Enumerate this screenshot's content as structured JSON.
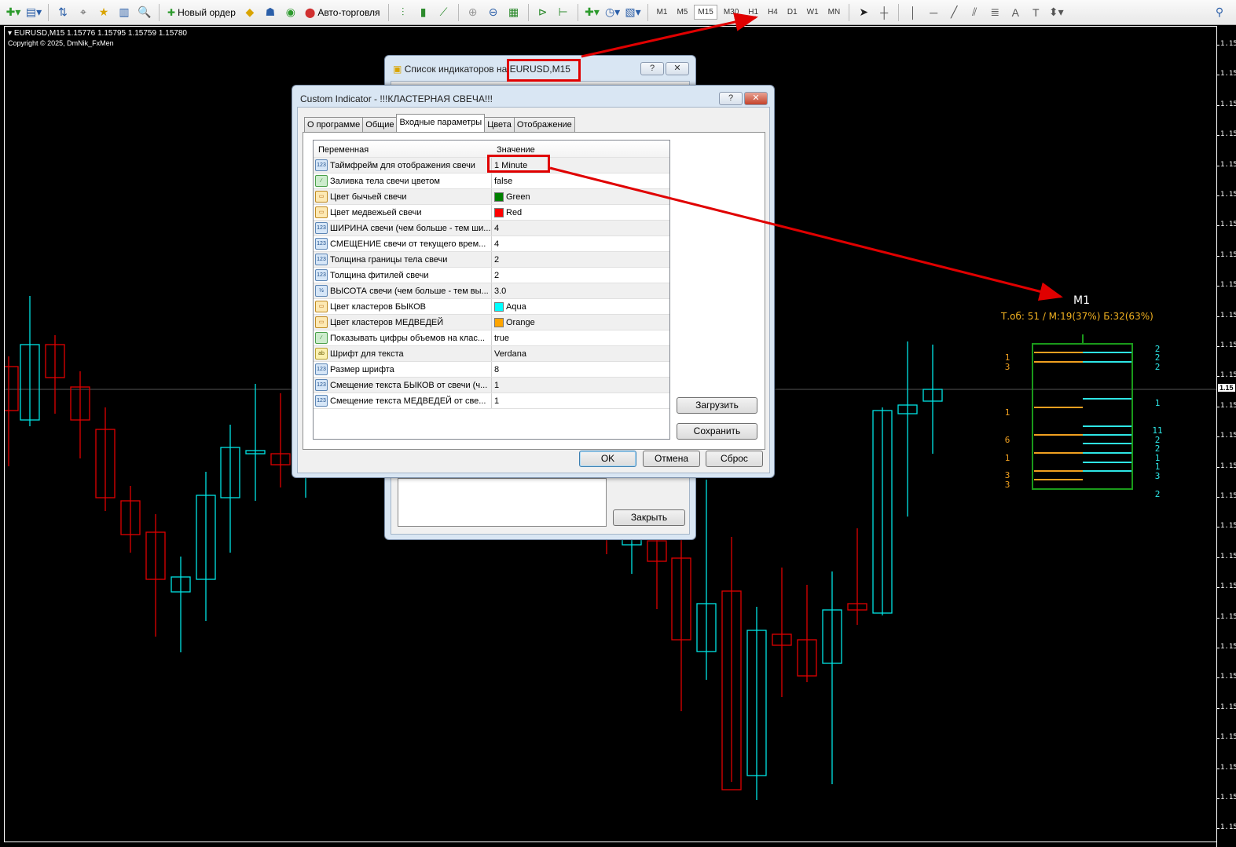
{
  "toolbar": {
    "new_order": "Новый ордер",
    "auto_trading": "Авто-торговля",
    "timeframes": [
      "M1",
      "M5",
      "M15",
      "M30",
      "H1",
      "H4",
      "D1",
      "W1",
      "MN"
    ],
    "active_timeframe": "M15"
  },
  "chart": {
    "symbol_line": "EURUSD,M15  1.15776 1.15795 1.15759 1.15780",
    "copyright": "Copyright © 2025, DmNik_FxMen",
    "axis_label": "1.15",
    "colors": {
      "background": "#000000",
      "bull": "#00e5e5",
      "bear": "#e00000"
    }
  },
  "cluster": {
    "timeframe": "M1",
    "summary": "Т.об: 51 / М:19(37%) Б:32(63%)",
    "bear_numbers": [
      "1",
      "3",
      "1",
      "6",
      "1",
      "3",
      "3"
    ],
    "bull_numbers": [
      "2",
      "2",
      "2",
      "1",
      "11",
      "2",
      "2",
      "1",
      "1",
      "3",
      "2"
    ],
    "colors": {
      "frame": "#1a9a1a",
      "bull": "#2ee6e6",
      "bear": "#f0a020"
    }
  },
  "indicator_list_dialog": {
    "title": "Список индикаторов на EURUSD,M15",
    "close_button": "Закрыть"
  },
  "custom_indicator_dialog": {
    "title": "Custom Indicator - !!!КЛАСТЕРНАЯ СВЕЧА!!!",
    "help": "?",
    "tabs": [
      "О программе",
      "Общие",
      "Входные параметры",
      "Цвета",
      "Отображение"
    ],
    "active_tab": "Входные параметры",
    "columns": [
      "Переменная",
      "Значение"
    ],
    "params": [
      {
        "icon": "123",
        "name": "Таймфрейм для отображения свечи",
        "value": "1 Minute"
      },
      {
        "icon": "bool",
        "name": "Заливка тела свечи цветом",
        "value": "false"
      },
      {
        "icon": "color",
        "name": "Цвет бычьей свечи",
        "value": "Green",
        "color": "#008000"
      },
      {
        "icon": "color",
        "name": "Цвет медвежьей свечи",
        "value": "Red",
        "color": "#ff0000"
      },
      {
        "icon": "123",
        "name": "ШИРИНА свечи (чем больше - тем ши...",
        "value": "4"
      },
      {
        "icon": "123",
        "name": "СМЕЩЕНИЕ свечи от текущего врем...",
        "value": "4"
      },
      {
        "icon": "123",
        "name": "Толщина границы тела свечи",
        "value": "2"
      },
      {
        "icon": "123",
        "name": "Толщина фитилей свечи",
        "value": "2"
      },
      {
        "icon": "1/2",
        "name": "ВЫСОТА свечи (чем больше - тем вы...",
        "value": "3.0"
      },
      {
        "icon": "color",
        "name": "Цвет кластеров БЫКОВ",
        "value": "Aqua",
        "color": "#00ffff"
      },
      {
        "icon": "color",
        "name": "Цвет кластеров МЕДВЕДЕЙ",
        "value": "Orange",
        "color": "#ffa500"
      },
      {
        "icon": "bool",
        "name": "Показывать цифры объемов на клас...",
        "value": "true"
      },
      {
        "icon": "ab",
        "name": "Шрифт для текста",
        "value": "Verdana"
      },
      {
        "icon": "123",
        "name": "Размер шрифта",
        "value": "8"
      },
      {
        "icon": "123",
        "name": "Смещение текста БЫКОВ от свечи (ч...",
        "value": "1"
      },
      {
        "icon": "123",
        "name": "Смещение текста МЕДВЕДЕЙ от све...",
        "value": "1"
      }
    ],
    "load": "Загрузить",
    "save": "Сохранить",
    "ok": "OK",
    "cancel": "Отмена",
    "reset": "Сброс"
  }
}
